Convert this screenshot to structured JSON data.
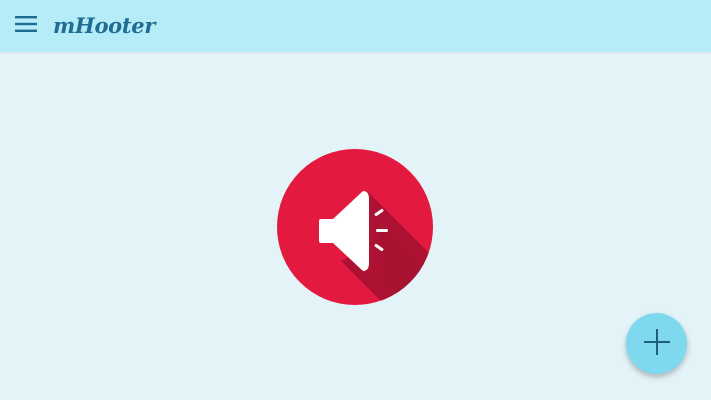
{
  "app": {
    "title": "mHooter"
  },
  "icons": {
    "menu": "hamburger-menu-icon",
    "hooter": "megaphone-icon",
    "add": "plus-icon"
  },
  "colors": {
    "toolbar": "#b6ebf8",
    "background": "#e3f3f8",
    "title": "#1f6d93",
    "hooter_button": "#e3193f",
    "fab": "#7fd9ee"
  }
}
